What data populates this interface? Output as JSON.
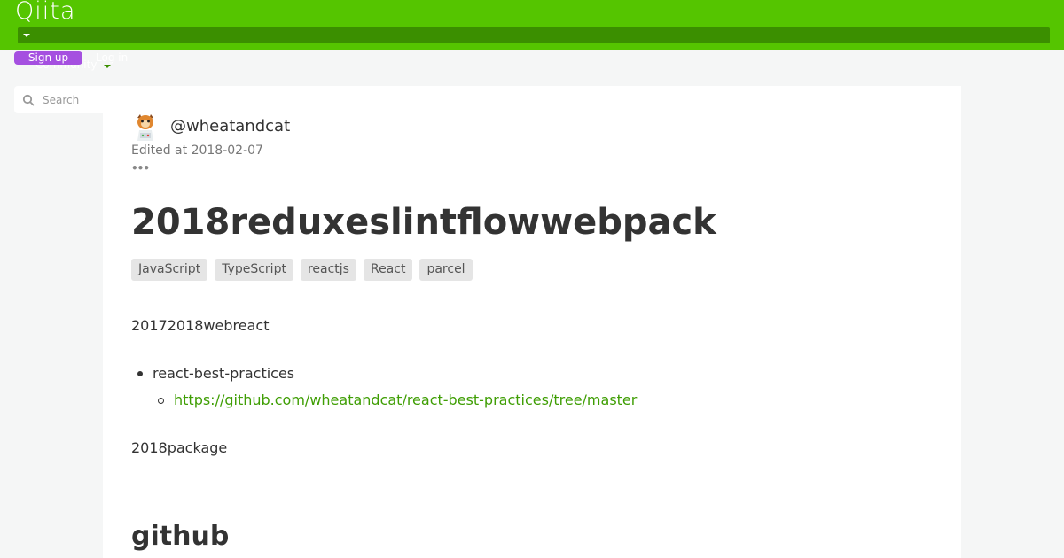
{
  "header": {
    "logo": "Qiita"
  },
  "auth": {
    "signup_label": "Sign up",
    "login_label": "Log in",
    "community_label": "Community"
  },
  "search": {
    "placeholder": "Search"
  },
  "article": {
    "author": "@wheatandcat",
    "edited": "Edited at 2018-02-07",
    "more": "•••",
    "title": "2018reduxeslintflowwebpack",
    "tags": [
      "JavaScript",
      "TypeScript",
      "reactjs",
      "React",
      "parcel"
    ],
    "intro": "20172018webreact",
    "list_item": "react-best-practices",
    "link": "https://github.com/wheatandcat/react-best-practices/tree/master",
    "paragraph2": "2018package",
    "heading": "github"
  },
  "colors": {
    "brand": "#55c500",
    "nav": "#3b8f00",
    "signup": "#a550e0",
    "link": "#3f9e04"
  }
}
